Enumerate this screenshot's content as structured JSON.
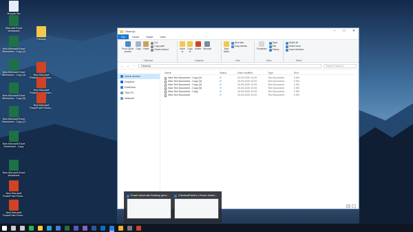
{
  "desktop": {
    "icons": [
      {
        "label": "Recycle Bin",
        "kind": "doc"
      },
      {
        "label": "Microsoft Excel\nWorksheet",
        "kind": "excel"
      },
      {
        "label": "Cleanup",
        "kind": "folder"
      },
      {
        "label": "New Microsoft Excel\nWorksheet - Copy (2)",
        "kind": "excel"
      },
      {
        "label": "New Microsoft Excel\nWorksheet - Copy (3)",
        "kind": "excel"
      },
      {
        "label": "New Microsoft\nPowerPoint Presen...",
        "kind": "ppt"
      },
      {
        "label": "New Microsoft Excel\nWorksheet - Copy (5)",
        "kind": "excel"
      },
      {
        "label": "New Microsoft\nPowerPoint Presen...",
        "kind": "ppt"
      },
      {
        "label": "New Microsoft Excel\nWorksheet - Copy (7)",
        "kind": "excel"
      },
      {
        "label": "New Microsoft\nPowerPoint Presen...",
        "kind": "ppt"
      },
      {
        "label": "New Microsoft Excel\nWorksheet - Copy",
        "kind": "excel"
      },
      {
        "label": "New Microsoft Excel\nWorksheet",
        "kind": "excel"
      },
      {
        "label": "New Microsoft\nPowerPoint Prese...",
        "kind": "ppt"
      },
      {
        "label": "New Microsoft\nPowerPoint Prese...",
        "kind": "ppt"
      },
      {
        "label": "New Microsoft\nPowerPoint Prese...",
        "kind": "ppt"
      }
    ]
  },
  "explorer": {
    "title": "CleanUp",
    "tabs": [
      "File",
      "Home",
      "Share",
      "View"
    ],
    "ribbon": {
      "clipboard": {
        "pin": "Pin to Quick\naccess",
        "copy": "Copy",
        "paste": "Paste",
        "cut": "Cut",
        "copy_path": "Copy path",
        "paste_shortcut": "Paste shortcut",
        "label": "Clipboard"
      },
      "organize": {
        "move": "Move\nto",
        "copy": "Copy\nto",
        "delete": "Delete",
        "rename": "Rename",
        "label": "Organize"
      },
      "new": {
        "new_folder": "New\nfolder",
        "new_item": "New item",
        "easy_access": "Easy access",
        "label": "New"
      },
      "open": {
        "properties": "Properties",
        "open": "Open",
        "edit": "Edit",
        "history": "History",
        "label": "Open"
      },
      "select": {
        "select_all": "Select all",
        "select_none": "Select none",
        "invert": "Invert selection",
        "label": "Select"
      }
    },
    "address": "CleanUp",
    "search_placeholder": "Search CleanUp",
    "nav": [
      "Quick access",
      "Dropbox",
      "OneDrive",
      "This PC",
      "Network"
    ],
    "columns": {
      "name": "Name",
      "status": "Status",
      "date": "Date modified",
      "type": "Type",
      "size": "Size"
    },
    "files": [
      {
        "name": "New Text Document - Copy (2)",
        "status": "⟳",
        "date": "24-09-2020 10:00",
        "type": "Text Document",
        "size": "0 KB"
      },
      {
        "name": "New Text Document - Copy (3)",
        "status": "⟳",
        "date": "24-09-2020 10:00",
        "type": "Text Document",
        "size": "0 KB"
      },
      {
        "name": "New Text Document - Copy (4)",
        "status": "⟳",
        "date": "24-09-2020 10:00",
        "type": "Text Document",
        "size": "0 KB"
      },
      {
        "name": "New Text Document - Copy (5)",
        "status": "⟳",
        "date": "24-09-2020 10:00",
        "type": "Text Document",
        "size": "0 KB"
      },
      {
        "name": "New Text Document - Copy",
        "status": "⟳",
        "date": "24-09-2020 10:00",
        "type": "Text Document",
        "size": "0 KB"
      },
      {
        "name": "New Text Document",
        "status": "⟳",
        "date": "24-09-2020 10:00",
        "type": "Text Document",
        "size": "0 KB"
      }
    ]
  },
  "thumbnails": [
    {
      "title": "Power Automate Desktop (prev..."
    },
    {
      "title": "CheckedFolders | Power Autom..."
    }
  ],
  "taskbar": {
    "icons": [
      "windows-start-icon",
      "search-icon",
      "task-view-icon",
      "spotify-icon",
      "file-explorer-icon",
      "edge-icon",
      "store-icon",
      "excel-icon",
      "teams-icon",
      "visual-studio-icon",
      "word-icon",
      "outlook-icon",
      "power-automate-icon",
      "chrome-icon",
      "camera-icon",
      "powerpoint-icon"
    ],
    "colors": [
      "#ffffff",
      "#cccccc",
      "#cccccc",
      "#1db954",
      "#f3c84b",
      "#2a9fd8",
      "#3f7fd8",
      "#1e7145",
      "#5059c9",
      "#8661c5",
      "#2b579a",
      "#0072c6",
      "#2a7be4",
      "#e4b62a",
      "#777777",
      "#d04423"
    ]
  }
}
